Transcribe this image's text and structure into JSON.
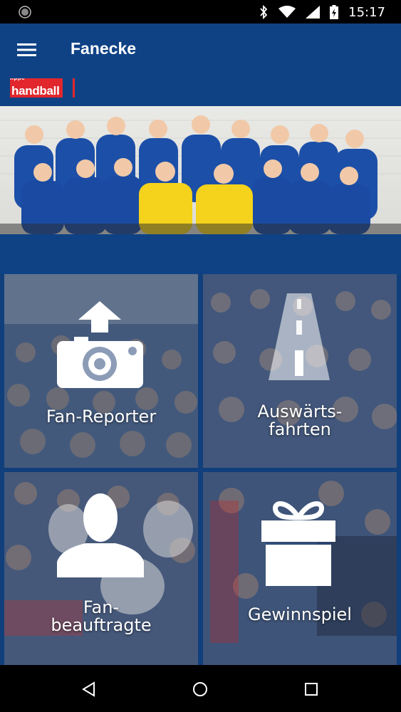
{
  "status_bar": {
    "time": "15:17",
    "icons": [
      "notification-dot-icon",
      "bluetooth-icon",
      "wifi-icon",
      "signal-icon",
      "battery-charging-icon"
    ]
  },
  "app_bar": {
    "title": "Fanecke",
    "menu_icon": "hamburger-menu-icon"
  },
  "logo": {
    "text": "handball",
    "tagline": "lippe"
  },
  "tiles": [
    {
      "id": "fan-reporter",
      "label": "Fan-Reporter",
      "icon": "camera-upload-icon"
    },
    {
      "id": "auswaertsfahrten",
      "label_line1": "Auswärts-",
      "label_line2": "fahrten",
      "icon": "road-icon"
    },
    {
      "id": "fanbeauftragte",
      "label_line1": "Fan-",
      "label_line2": "beauftragte",
      "icon": "person-icon"
    },
    {
      "id": "gewinnspiel",
      "label": "Gewinnspiel",
      "icon": "gift-icon"
    }
  ],
  "nav_bar": {
    "buttons": [
      "back-icon",
      "home-icon",
      "recents-icon"
    ]
  },
  "colors": {
    "brand_blue": "#0f4285",
    "logo_red": "#e1272d"
  }
}
